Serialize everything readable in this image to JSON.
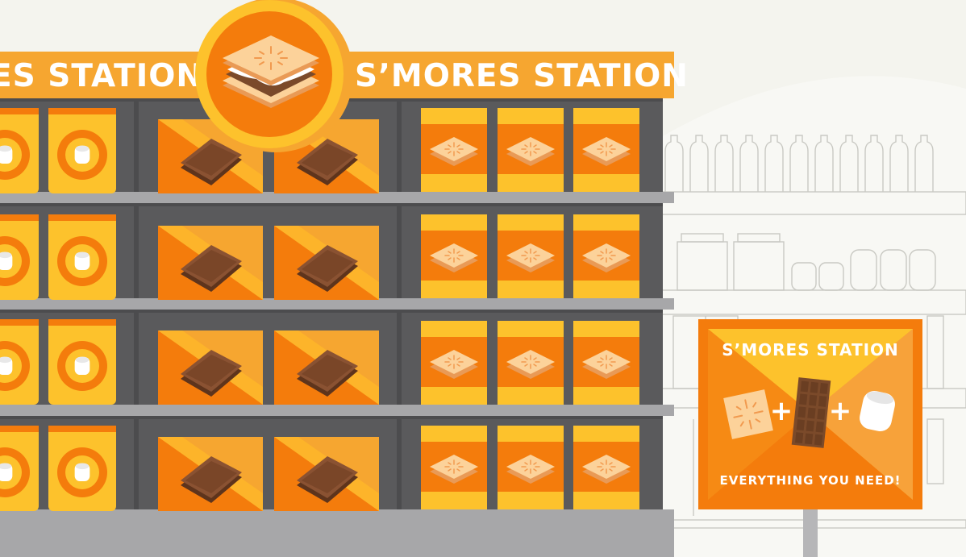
{
  "banner": {
    "left_text": "ES STATION",
    "right_text": "S’MORES STATION"
  },
  "sign": {
    "title": "S’MORES STATION",
    "footer": "EVERYTHING YOU NEED!",
    "plus_1": "+",
    "plus_2": "+"
  },
  "colors": {
    "background": "#f4f4ee",
    "banner": "#f6a630",
    "shelf_frame": "#5a5a5c",
    "shelf_board": "#a7a7a9",
    "orange": "#f47c0c",
    "yellow": "#fdc22c",
    "chocolate": "#7b4a2a",
    "cracker": "#fbc98b"
  }
}
